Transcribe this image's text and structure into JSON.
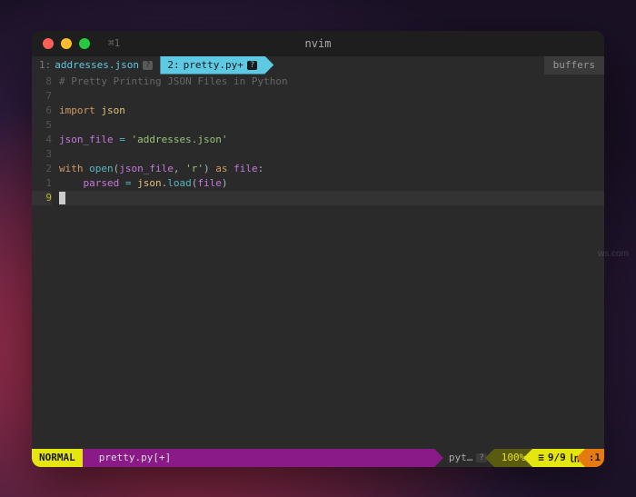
{
  "titlebar": {
    "title": "nvim",
    "term_tab": "⌘1"
  },
  "bufferline": {
    "tabs": [
      {
        "num": "1:",
        "name": "addresses.json",
        "mod": "?"
      },
      {
        "num": "2:",
        "name": "pretty.py+",
        "mod": "?"
      }
    ],
    "label": "buffers"
  },
  "gutter": [
    "8",
    "7",
    "6",
    "5",
    "4",
    "3",
    "2",
    "1",
    "9"
  ],
  "code": [
    {
      "t": "comment",
      "text": "# Pretty Printing JSON Files in Python"
    },
    {
      "t": "blank",
      "text": ""
    },
    {
      "t": "import",
      "kw": "import",
      "mod": "json"
    },
    {
      "t": "blank",
      "text": ""
    },
    {
      "t": "assign",
      "var": "json_file",
      "eq": " = ",
      "str": "'addresses.json'"
    },
    {
      "t": "blank",
      "text": ""
    },
    {
      "t": "with",
      "kw1": "with",
      "func": "open",
      "open": "(",
      "arg1": "json_file",
      "comma": ", ",
      "arg2": "'r'",
      "close": ")",
      "kw2": "as",
      "var2": "file",
      "colon": ":"
    },
    {
      "t": "indent",
      "indent": "    ",
      "var": "parsed",
      "eq": " = ",
      "obj": "json",
      "dot": ".",
      "func": "load",
      "open": "(",
      "arg": "file",
      "close": ")"
    },
    {
      "t": "cursor"
    }
  ],
  "statusline": {
    "mode": "NORMAL",
    "file": "pretty.py[+]",
    "filetype": "pyt…",
    "ft_icon": "?",
    "percent": "100%",
    "sep": "≡",
    "line_pos": "9/9",
    "col_icon": "㏑",
    "col": ":1"
  },
  "watermark": "ws.com"
}
